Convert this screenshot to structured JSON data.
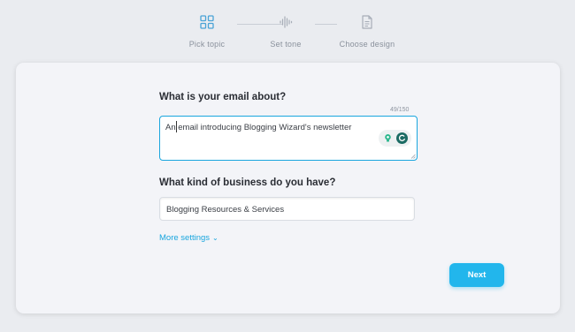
{
  "stepper": {
    "steps": [
      {
        "label": "Pick topic",
        "icon": "grid-icon",
        "state": "active",
        "color": "#4aa3d6"
      },
      {
        "label": "Set tone",
        "icon": "waveform-icon",
        "state": "inactive"
      },
      {
        "label": "Choose design",
        "icon": "document-icon",
        "state": "inactive"
      }
    ]
  },
  "form": {
    "email_about": {
      "label": "What is your email about?",
      "counter": "49/150",
      "value": "An email introducing Blogging Wizard's newsletter"
    },
    "business": {
      "label": "What kind of business do you have?",
      "value": "Blogging Resources & Services"
    },
    "more_settings": {
      "label": "More settings",
      "icon": "chevron-down-icon"
    },
    "next_button": "Next"
  },
  "colors": {
    "accent": "#1aa6de",
    "button": "#22b6ec",
    "grammar_badge": "#1b6b63",
    "bulb": "#2fb88f"
  }
}
